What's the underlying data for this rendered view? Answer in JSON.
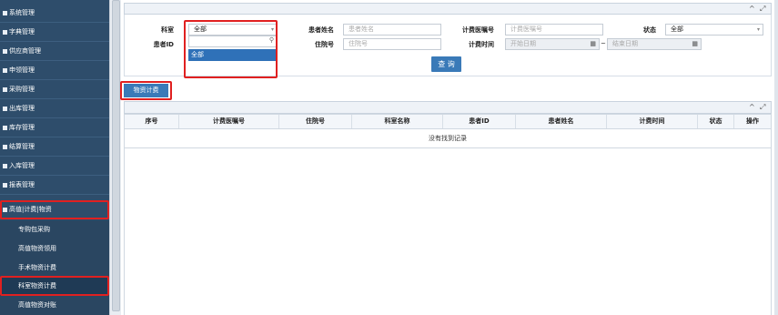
{
  "sidebar": {
    "menu": [
      "系统管理",
      "字典管理",
      "供应商管理",
      "申领管理",
      "采购管理",
      "出库管理",
      "库存管理",
      "结算管理",
      "入库管理",
      "报表管理",
      "高值|计费|物资"
    ],
    "submenu": [
      "专购包采购",
      "高值物资领用",
      "手术物资计费",
      "科室物资计费",
      "高值物资对账"
    ]
  },
  "panel": {
    "collapse_icon": "^",
    "expand_icon": "⤢"
  },
  "form": {
    "dept_label": "科室",
    "dept_value": "全部",
    "dept_option": "全部",
    "patient_name_label": "患者姓名",
    "patient_name_placeholder": "患者姓名",
    "billing_no_label": "计费医嘱号",
    "billing_no_placeholder": "计费医嘱号",
    "status_label": "状态",
    "status_value": "全部",
    "patient_id_label": "患者ID",
    "admission_no_label": "住院号",
    "admission_no_placeholder": "住院号",
    "billing_time_label": "计费时间",
    "start_date_placeholder": "开始日期",
    "date_sep": "~",
    "end_date_placeholder": "结束日期",
    "query_button": "查 询"
  },
  "actions": {
    "billing_button": "物资计费"
  },
  "grid": {
    "columns": [
      "序号",
      "计费医嘱号",
      "住院号",
      "科室名称",
      "患者ID",
      "患者姓名",
      "计费时间",
      "状态",
      "操作"
    ],
    "empty_text": "没有找到记录"
  }
}
